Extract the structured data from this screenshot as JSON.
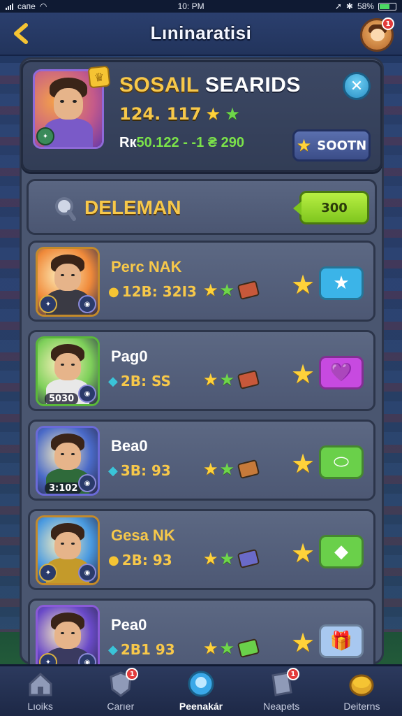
{
  "status_bar": {
    "carrier": "caпe",
    "time": "10: PM",
    "battery": "58%",
    "battery_level": 0.58
  },
  "header": {
    "title": "Lıninaratisi",
    "notification_count": "1"
  },
  "profile": {
    "name_first": "SOSAIL",
    "name_rest": "SEARIDS",
    "stats": "124. 117",
    "rank_prefix": "Rк",
    "rank_value": "50.122",
    "rank_suffix": "- -1 ₴ 290",
    "close_label": "✕",
    "soon_label": "SOOTN"
  },
  "search": {
    "label": "DELEMAN",
    "button_label": "300"
  },
  "rows": [
    {
      "name": "Perc NAK",
      "name_color": "#f7c84a",
      "stat": "12B: 32I3",
      "gem": "coin",
      "level": "",
      "frame": "#c48a2a",
      "sky": "#f08a3a",
      "body": "#3a3a44",
      "gift": "#c7583a",
      "action_color": "#3bb4e8",
      "action_icon": "★"
    },
    {
      "name": "Pag0",
      "name_color": "#ffffff",
      "stat": "2B: SS",
      "gem": "gem",
      "level": "5030",
      "frame": "#5ab83a",
      "sky": "#7ed05a",
      "body": "#e8e8e8",
      "gift": "#c7583a",
      "action_color": "#c74ae0",
      "action_icon": "💜"
    },
    {
      "name": "Bea0",
      "name_color": "#ffffff",
      "stat": "3B: 93",
      "gem": "gem",
      "level": "3:102",
      "frame": "#6a6ad8",
      "sky": "#4a6ac8",
      "body": "#2f6a3a",
      "gift": "#c77a3a",
      "action_color": "#6ad04a",
      "action_icon": "⬭"
    },
    {
      "name": "Gesa NK",
      "name_color": "#f7c84a",
      "stat": "2B: 93",
      "gem": "coin",
      "level": "",
      "frame": "#c48a2a",
      "sky": "#4a9ae0",
      "body": "#c49a2a",
      "gift": "#6a6ac8",
      "action_color": "#6ad04a",
      "action_icon": "◆"
    },
    {
      "name": "Pea0",
      "name_color": "#ffffff",
      "stat": "2B1 93",
      "gem": "gem",
      "level": "",
      "frame": "#8a5ad8",
      "sky": "#6a4ac8",
      "body": "#3a3a60",
      "gift": "#6ad04a",
      "action_color": "#a8c8f0",
      "action_icon": "🎁"
    }
  ],
  "nav": [
    {
      "label": "Lıoiks",
      "icon": "home-icon",
      "badge": ""
    },
    {
      "label": "Carıer",
      "icon": "shield-icon",
      "badge": "1"
    },
    {
      "label": "Peenakár",
      "icon": "trophy-icon",
      "badge": ""
    },
    {
      "label": "Neapets",
      "icon": "card-icon",
      "badge": "1"
    },
    {
      "label": "Deiterns",
      "icon": "coin-icon",
      "badge": ""
    }
  ]
}
